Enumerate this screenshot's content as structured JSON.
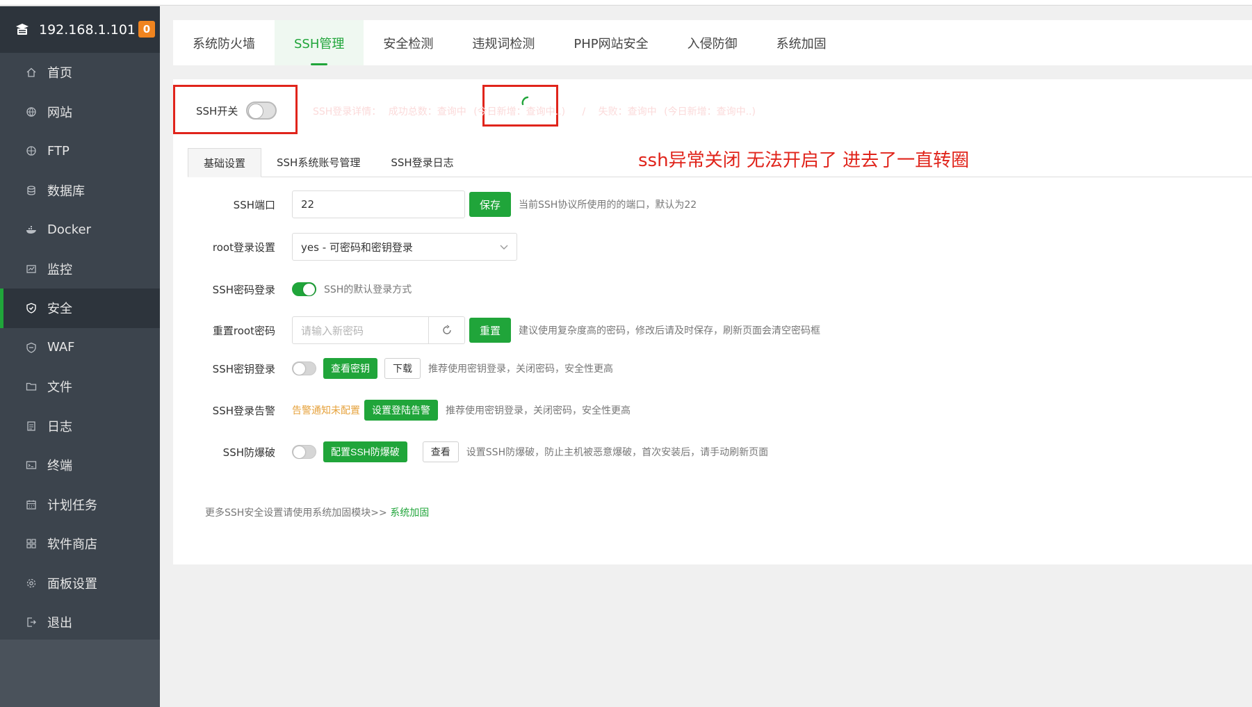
{
  "sidebar": {
    "host": "192.168.1.101",
    "badge": "0",
    "items": [
      {
        "label": "首页",
        "icon": "home-icon"
      },
      {
        "label": "网站",
        "icon": "globe-icon"
      },
      {
        "label": "FTP",
        "icon": "ftp-icon"
      },
      {
        "label": "数据库",
        "icon": "database-icon"
      },
      {
        "label": "Docker",
        "icon": "docker-icon"
      },
      {
        "label": "监控",
        "icon": "monitor-icon"
      },
      {
        "label": "安全",
        "icon": "shield-icon"
      },
      {
        "label": "WAF",
        "icon": "waf-shield-icon"
      },
      {
        "label": "文件",
        "icon": "folder-icon"
      },
      {
        "label": "日志",
        "icon": "log-icon"
      },
      {
        "label": "终端",
        "icon": "terminal-icon"
      },
      {
        "label": "计划任务",
        "icon": "calendar-icon"
      },
      {
        "label": "软件商店",
        "icon": "apps-grid-icon"
      },
      {
        "label": "面板设置",
        "icon": "gear-icon"
      },
      {
        "label": "退出",
        "icon": "logout-icon"
      }
    ],
    "active_index": 6
  },
  "tabs": [
    "系统防火墙",
    "SSH管理",
    "安全检测",
    "违规词检测",
    "PHP网站安全",
    "入侵防御",
    "系统加固"
  ],
  "ssh": {
    "switch_label": "SSH开关",
    "info": {
      "detail_label": "SSH登录详情：",
      "success_total": "成功总数：查询中",
      "success_today": "(今日新增：查询中..)",
      "sep": "/",
      "fail_total": "失败：查询中",
      "fail_today": "(今日新增：查询中..)"
    }
  },
  "annotation": "ssh异常关闭  无法开启了 进去了一直转圈",
  "subtabs": [
    "基础设置",
    "SSH系统账号管理",
    "SSH登录日志"
  ],
  "form": {
    "port": {
      "label": "SSH端口",
      "value": "22",
      "button": "保存",
      "hint": "当前SSH协议所使用的的端口，默认为22"
    },
    "root_login": {
      "label": "root登录设置",
      "value": "yes - 可密码和密钥登录"
    },
    "password_login": {
      "label": "SSH密码登录",
      "hint": "SSH的默认登录方式"
    },
    "reset_root": {
      "label": "重置root密码",
      "placeholder": "请输入新密码",
      "button": "重置",
      "hint": "建议使用复杂度高的密码，修改后请及时保存，刷新页面会清空密码框"
    },
    "key_login": {
      "label": "SSH密钥登录",
      "view_button": "查看密钥",
      "download_button": "下载",
      "hint": "推荐使用密钥登录，关闭密码，安全性更高"
    },
    "login_alert": {
      "label": "SSH登录告警",
      "warn": "告警通知未配置",
      "button": "设置登陆告警",
      "hint": "推荐使用密钥登录，关闭密码，安全性更高"
    },
    "brute_force": {
      "label": "SSH防爆破",
      "config_button": "配置SSH防爆破",
      "view_button": "查看",
      "hint": "设置SSH防爆破，防止主机被恶意爆破，首次安装后，请手动刷新页面"
    }
  },
  "footer": {
    "text": "更多SSH安全设置请使用系统加固模块>> ",
    "link": "系统加固"
  }
}
